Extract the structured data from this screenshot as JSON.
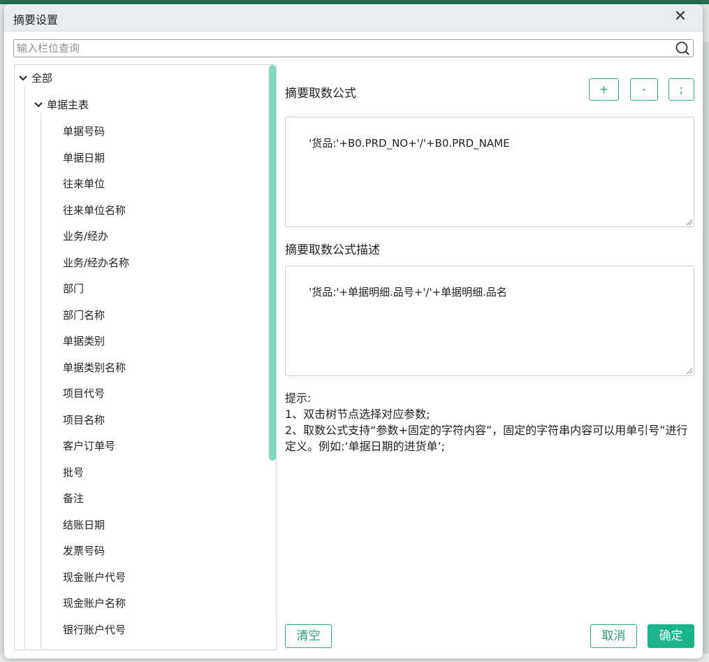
{
  "dialog": {
    "title": "摘要设置",
    "close_glyph": "✕"
  },
  "search": {
    "placeholder": "输入栏位查询",
    "value": ""
  },
  "tree": {
    "root_label": "全部",
    "group_label": "单据主表",
    "items": [
      "单据号码",
      "单据日期",
      "往来单位",
      "往来单位名称",
      "业务/经办",
      "业务/经办名称",
      "部门",
      "部门名称",
      "单据类别",
      "单据类别名称",
      "项目代号",
      "项目名称",
      "客户订单号",
      "批号",
      "备注",
      "结账日期",
      "发票号码",
      "现金账户代号",
      "现金账户名称",
      "银行账户代号"
    ]
  },
  "formula": {
    "label": "摘要取数公式",
    "value": "'货品:'+B0.PRD_NO+'/'+B0.PRD_NAME",
    "buttons": {
      "plus": "+",
      "minus": "-",
      "semicolon": ";"
    }
  },
  "description": {
    "label": "摘要取数公式描述",
    "value": "'货品:'+单据明细.品号+'/'+单据明细.品名"
  },
  "hint": {
    "title": "提示:",
    "line1": "1、双击树节点选择对应参数;",
    "line2": "2、取数公式支持“参数+固定的字符内容”，固定的字符串内容可以用单引号”进行定义。例如:‘单据日期的进货单’;"
  },
  "footer": {
    "clear_label": "清空",
    "cancel_label": "取消",
    "ok_label": "确定"
  },
  "icons": {
    "search": "search-icon",
    "close": "close-icon",
    "expand": "chevron-down-icon"
  },
  "colors": {
    "accent": "#1db38a",
    "accent_text": "#2a9a7e",
    "scrollbar": "#7fd8be",
    "titlebar": "#e9edf0"
  }
}
